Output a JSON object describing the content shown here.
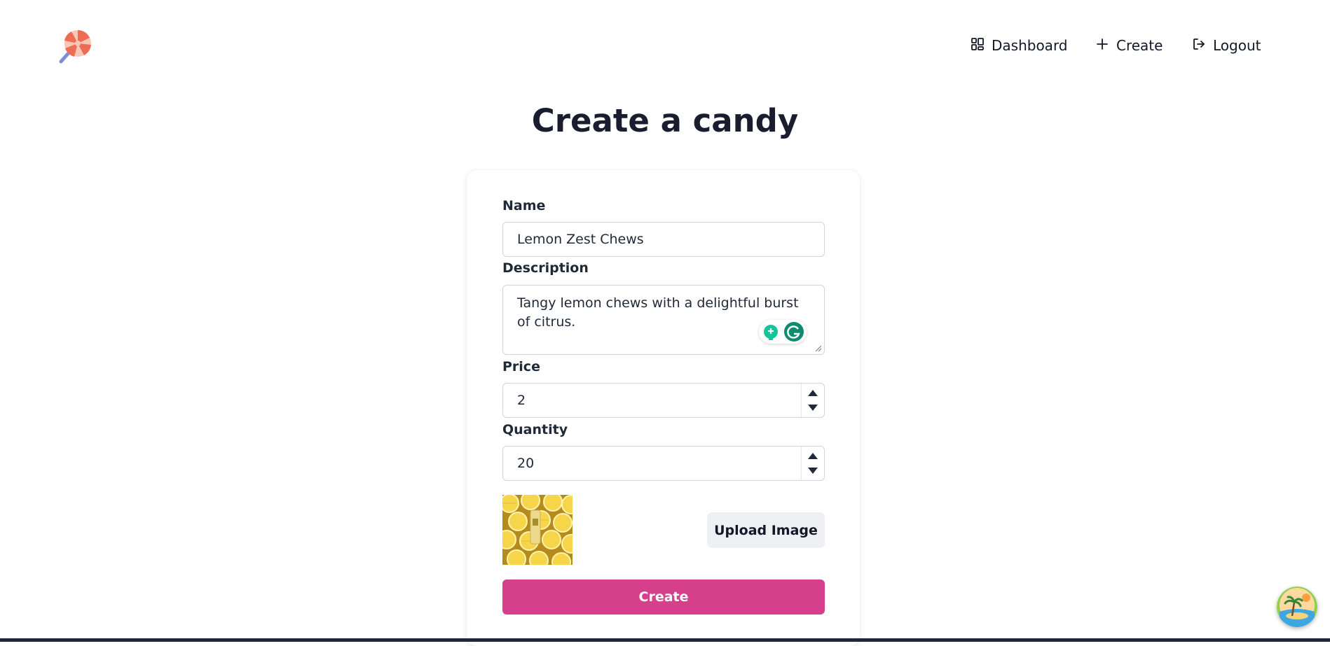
{
  "nav": {
    "dashboard": "Dashboard",
    "create": "Create",
    "logout": "Logout"
  },
  "page": {
    "title": "Create a candy"
  },
  "form": {
    "name_label": "Name",
    "name_value": "Lemon Zest Chews",
    "description_label": "Description",
    "description_value": "Tangy lemon chews with a delightful burst of citrus.",
    "price_label": "Price",
    "price_value": "2",
    "quantity_label": "Quantity",
    "quantity_value": "20",
    "upload_label": "Upload Image",
    "submit_label": "Create"
  },
  "icons": {
    "logo": "lollipop-icon",
    "dashboard": "grid-icon",
    "create": "plus-icon",
    "logout": "logout-icon"
  },
  "colors": {
    "primary": "#d63f8c",
    "secondary_button": "#eef0f3",
    "text": "#1a1d2e"
  }
}
